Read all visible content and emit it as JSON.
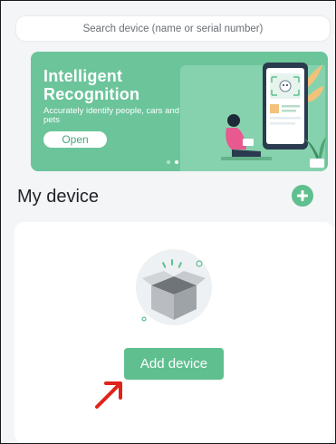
{
  "search": {
    "placeholder": "Search device (name or serial number)"
  },
  "banner": {
    "title": "Intelligent\nRecognition",
    "subtitle": "Accurately identify people, cars and pets",
    "open_label": "Open",
    "page_count": 2,
    "active_page": 2
  },
  "section": {
    "title": "My device",
    "add_icon": "plus-circle-icon"
  },
  "empty_state": {
    "illustration": "open-box-icon",
    "button_label": "Add device"
  },
  "annotation": {
    "icon": "red-arrow-icon"
  },
  "colors": {
    "accent": "#5fbf8f",
    "banner": "#6cc49b",
    "annotation": "#e0231b"
  }
}
